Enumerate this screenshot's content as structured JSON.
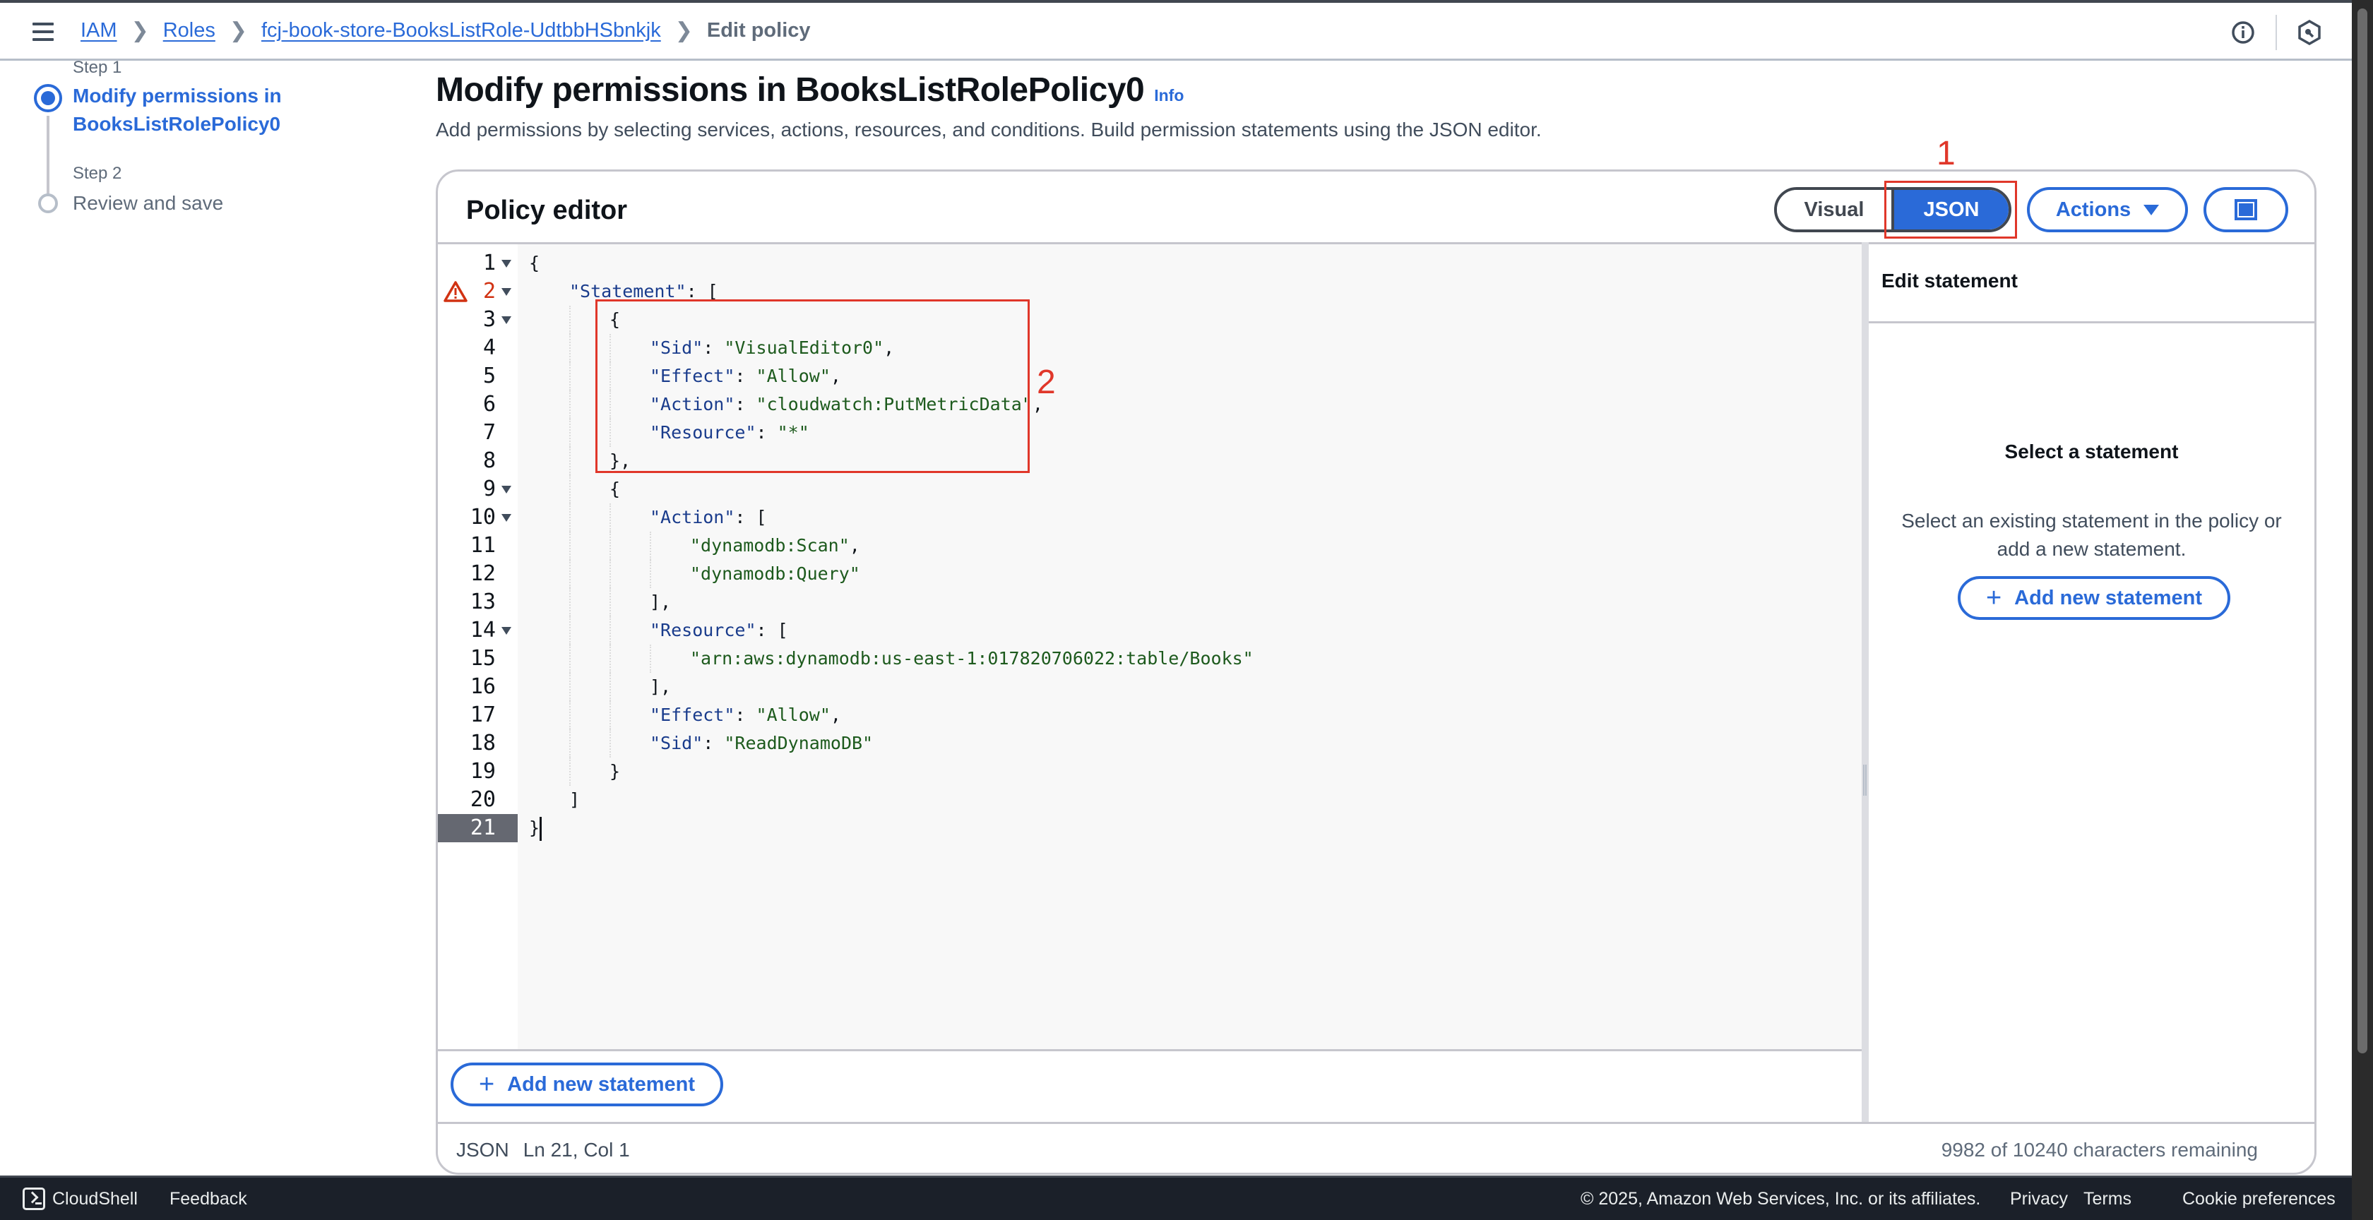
{
  "topbar": {
    "breadcrumb": [
      {
        "label": "IAM",
        "link": true
      },
      {
        "label": "Roles",
        "link": true
      },
      {
        "label": "fcj-book-store-BooksListRole-UdtbbHSbnkjk",
        "link": true
      },
      {
        "label": "Edit policy",
        "link": false
      }
    ],
    "icons": [
      "menu-icon",
      "info-circle-icon",
      "settings-hexagon-icon"
    ]
  },
  "steps": [
    {
      "step_label": "Step 1",
      "title": "Modify permissions in BooksListRolePolicy0",
      "state": "active"
    },
    {
      "step_label": "Step 2",
      "title": "Review and save",
      "state": "inactive"
    }
  ],
  "page": {
    "title": "Modify permissions in BooksListRolePolicy0",
    "info_link": "Info",
    "description": "Add permissions by selecting services, actions, resources, and conditions. Build permission statements using the JSON editor."
  },
  "annotations": {
    "one": "1",
    "two": "2"
  },
  "policy_editor": {
    "title": "Policy editor",
    "mode_toggle": {
      "options": [
        "Visual",
        "JSON"
      ],
      "selected": "JSON"
    },
    "actions_label": "Actions",
    "add_statement_label": "Add new statement",
    "code_lines": [
      {
        "n": "1",
        "fold": true,
        "indent": 0,
        "tokens": [
          [
            "p",
            "{"
          ]
        ]
      },
      {
        "n": "2",
        "fold": true,
        "indent": 1,
        "warning": true,
        "tokens": [
          [
            "k",
            "\"Statement\""
          ],
          [
            "p",
            ": ["
          ]
        ]
      },
      {
        "n": "3",
        "fold": true,
        "indent": 2,
        "tokens": [
          [
            "p",
            "{"
          ]
        ]
      },
      {
        "n": "4",
        "indent": 3,
        "tokens": [
          [
            "k",
            "\"Sid\""
          ],
          [
            "p",
            ": "
          ],
          [
            "s",
            "\"VisualEditor0\""
          ],
          [
            "p",
            ","
          ]
        ]
      },
      {
        "n": "5",
        "indent": 3,
        "tokens": [
          [
            "k",
            "\"Effect\""
          ],
          [
            "p",
            ": "
          ],
          [
            "s",
            "\"Allow\""
          ],
          [
            "p",
            ","
          ]
        ]
      },
      {
        "n": "6",
        "indent": 3,
        "tokens": [
          [
            "k",
            "\"Action\""
          ],
          [
            "p",
            ": "
          ],
          [
            "s",
            "\"cloudwatch:PutMetricData\""
          ],
          [
            "p",
            ","
          ]
        ]
      },
      {
        "n": "7",
        "indent": 3,
        "tokens": [
          [
            "k",
            "\"Resource\""
          ],
          [
            "p",
            ": "
          ],
          [
            "s",
            "\"*\""
          ]
        ]
      },
      {
        "n": "8",
        "indent": 2,
        "tokens": [
          [
            "p",
            "},"
          ]
        ]
      },
      {
        "n": "9",
        "fold": true,
        "indent": 2,
        "tokens": [
          [
            "p",
            "{"
          ]
        ]
      },
      {
        "n": "10",
        "fold": true,
        "indent": 3,
        "tokens": [
          [
            "k",
            "\"Action\""
          ],
          [
            "p",
            ": ["
          ]
        ]
      },
      {
        "n": "11",
        "indent": 4,
        "tokens": [
          [
            "s",
            "\"dynamodb:Scan\""
          ],
          [
            "p",
            ","
          ]
        ]
      },
      {
        "n": "12",
        "indent": 4,
        "tokens": [
          [
            "s",
            "\"dynamodb:Query\""
          ]
        ]
      },
      {
        "n": "13",
        "indent": 3,
        "tokens": [
          [
            "p",
            "],"
          ]
        ]
      },
      {
        "n": "14",
        "fold": true,
        "indent": 3,
        "tokens": [
          [
            "k",
            "\"Resource\""
          ],
          [
            "p",
            ": ["
          ]
        ]
      },
      {
        "n": "15",
        "indent": 4,
        "tokens": [
          [
            "s",
            "\"arn:aws:dynamodb:us-east-1:017820706022:table/Books\""
          ]
        ]
      },
      {
        "n": "16",
        "indent": 3,
        "tokens": [
          [
            "p",
            "],"
          ]
        ]
      },
      {
        "n": "17",
        "indent": 3,
        "tokens": [
          [
            "k",
            "\"Effect\""
          ],
          [
            "p",
            ": "
          ],
          [
            "s",
            "\"Allow\""
          ],
          [
            "p",
            ","
          ]
        ]
      },
      {
        "n": "18",
        "indent": 3,
        "tokens": [
          [
            "k",
            "\"Sid\""
          ],
          [
            "p",
            ": "
          ],
          [
            "s",
            "\"ReadDynamoDB\""
          ]
        ]
      },
      {
        "n": "19",
        "indent": 2,
        "tokens": [
          [
            "p",
            "}"
          ]
        ]
      },
      {
        "n": "20",
        "indent": 1,
        "tokens": [
          [
            "p",
            "]"
          ]
        ]
      },
      {
        "n": "21",
        "indent": 0,
        "active": true,
        "cursor": true,
        "tokens": [
          [
            "p",
            "}"
          ]
        ]
      }
    ],
    "side_panel": {
      "header": "Edit statement",
      "empty_title": "Select a statement",
      "empty_description": "Select an existing statement in the policy or add a new statement.",
      "add_statement_label": "Add new statement"
    },
    "status_bar": {
      "language": "JSON",
      "position": "Ln 21, Col 1",
      "characters_remaining": "9982 of 10240 characters remaining"
    }
  },
  "footer": {
    "cloudshell": "CloudShell",
    "feedback": "Feedback",
    "copyright": "© 2025, Amazon Web Services, Inc. or its affiliates.",
    "links": [
      "Privacy",
      "Terms",
      "Cookie preferences"
    ]
  },
  "colors": {
    "accent": "#2a6ad8",
    "annotation": "#e0372a",
    "error": "#d13212",
    "footer_bg": "#1b2029"
  }
}
